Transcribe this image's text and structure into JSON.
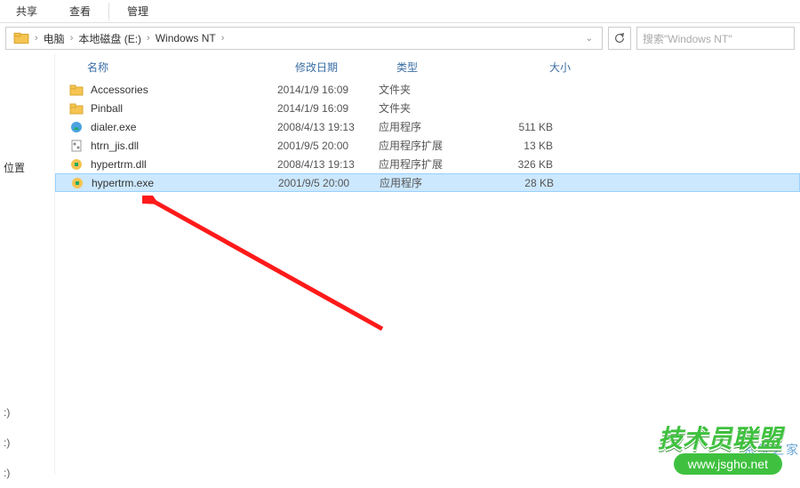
{
  "titlebar": {
    "share": "共享",
    "view": "查看",
    "manage": "管理"
  },
  "breadcrumb": {
    "computer": "电脑",
    "drive": "本地磁盘 (E:)",
    "folder": "Windows NT"
  },
  "search": {
    "placeholder": "搜索\"Windows NT\""
  },
  "sidebar": {
    "location": "位置"
  },
  "columns": {
    "name": "名称",
    "date": "修改日期",
    "type": "类型",
    "size": "大小"
  },
  "files": [
    {
      "name": "Accessories",
      "date": "2014/1/9 16:09",
      "type": "文件夹",
      "size": ""
    },
    {
      "name": "Pinball",
      "date": "2014/1/9 16:09",
      "type": "文件夹",
      "size": ""
    },
    {
      "name": "dialer.exe",
      "date": "2008/4/13 19:13",
      "type": "应用程序",
      "size": "511 KB"
    },
    {
      "name": "htrn_jis.dll",
      "date": "2001/9/5 20:00",
      "type": "应用程序扩展",
      "size": "13 KB"
    },
    {
      "name": "hypertrm.dll",
      "date": "2008/4/13 19:13",
      "type": "应用程序扩展",
      "size": "326 KB"
    },
    {
      "name": "hypertrm.exe",
      "date": "2001/9/5 20:00",
      "type": "应用程序",
      "size": "28 KB"
    }
  ],
  "watermark": {
    "brand": "技术员联盟",
    "url": "www.jsgho.net",
    "side": "系统之家"
  }
}
